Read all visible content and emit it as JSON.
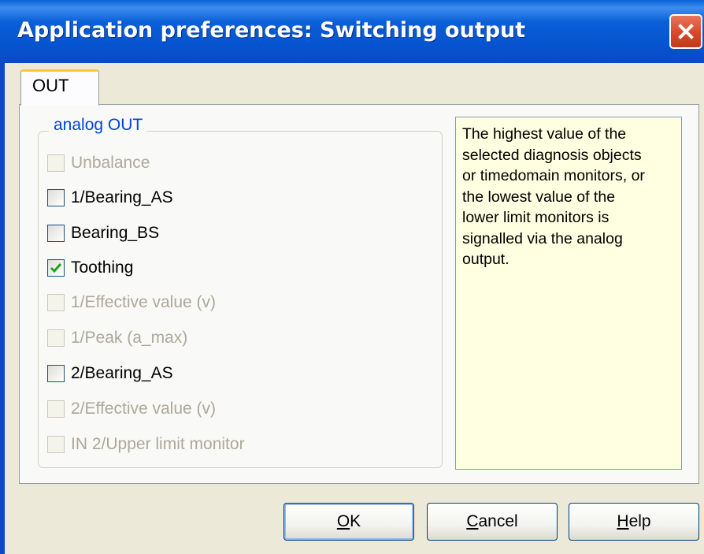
{
  "window": {
    "title": "Application preferences: Switching output"
  },
  "tabs": [
    {
      "label": "OUT",
      "selected": true
    }
  ],
  "group": {
    "label": "analog OUT",
    "items": [
      {
        "label": "Unbalance",
        "checked": false,
        "enabled": false
      },
      {
        "label": "1/Bearing_AS",
        "checked": false,
        "enabled": true
      },
      {
        "label": "Bearing_BS",
        "checked": false,
        "enabled": true
      },
      {
        "label": "Toothing",
        "checked": true,
        "enabled": true
      },
      {
        "label": "1/Effective value (v)",
        "checked": false,
        "enabled": false
      },
      {
        "label": "1/Peak (a_max)",
        "checked": false,
        "enabled": false
      },
      {
        "label": "2/Bearing_AS",
        "checked": false,
        "enabled": true
      },
      {
        "label": "2/Effective value (v)",
        "checked": false,
        "enabled": false
      },
      {
        "label": "IN 2/Upper limit monitor",
        "checked": false,
        "enabled": false
      }
    ]
  },
  "info": {
    "text": "The highest value of the\nselected diagnosis objects\nor timedomain monitors, or\nthe lowest value of the\nlower limit monitors is\nsignalled via the analog\noutput."
  },
  "buttons": {
    "ok": {
      "first": "O",
      "rest": "K"
    },
    "cancel": {
      "first": "C",
      "rest": "ancel"
    },
    "help": {
      "first": "H",
      "rest": "elp"
    }
  },
  "colors": {
    "titlebar": "#0a5fd7",
    "group_label": "#0046d5",
    "info_background": "#ffffe1",
    "close_button": "#d9482a",
    "check": "#21a121"
  }
}
